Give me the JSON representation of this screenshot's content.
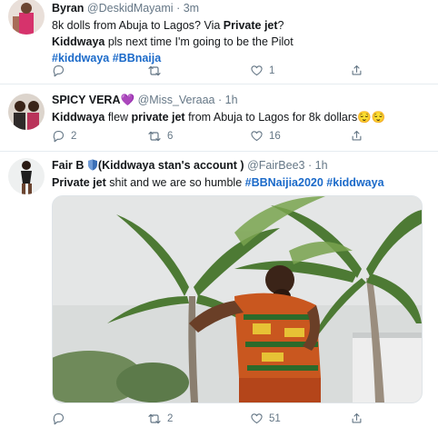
{
  "tweets": [
    {
      "name": "Byran",
      "handle": "@DeskidMayami",
      "sep": "·",
      "time": "3m",
      "line1_pre": "8k dolls from Abuja to Lagos? Via ",
      "line1_bold": "Private jet",
      "line1_post": "?",
      "line2_bold": "Kiddwaya",
      "line2_rest": " pls next time I'm going to be the Pilot",
      "tag1": "#kiddwaya",
      "tag2": "#BBnaija",
      "reply_count": "",
      "retweet_count": "",
      "like_count": "1"
    },
    {
      "name": "SPICY VERA",
      "name_emoji": "💜",
      "handle": "@Miss_Veraaa",
      "sep": "·",
      "time": "1h",
      "line1_bold": "Kiddwaya",
      "line1_mid": " flew ",
      "line1_bold2": "private jet",
      "line1_post": " from Abuja to Lagos for 8k dollars",
      "line1_emoji": "😌😌",
      "reply_count": "2",
      "retweet_count": "6",
      "like_count": "16"
    },
    {
      "name_pre": "Fair B",
      "name_post": "(Kiddwaya stan's account )",
      "handle": "@FairBee3",
      "sep": "·",
      "time": "1h",
      "line1_bold": "Private jet",
      "line1_rest": " shit and we are so humble ",
      "tag1": "#BBNaijia2020",
      "tag2": "#kiddwaya",
      "reply_count": "",
      "retweet_count": "2",
      "like_count": "51"
    }
  ],
  "icons": [
    "reply-icon",
    "retweet-icon",
    "like-icon",
    "share-icon",
    "shield-icon"
  ],
  "colors": {
    "text": "#14171a",
    "meta": "#657786",
    "hashtag": "#1b6ac9",
    "divider": "#e6ecf0"
  }
}
